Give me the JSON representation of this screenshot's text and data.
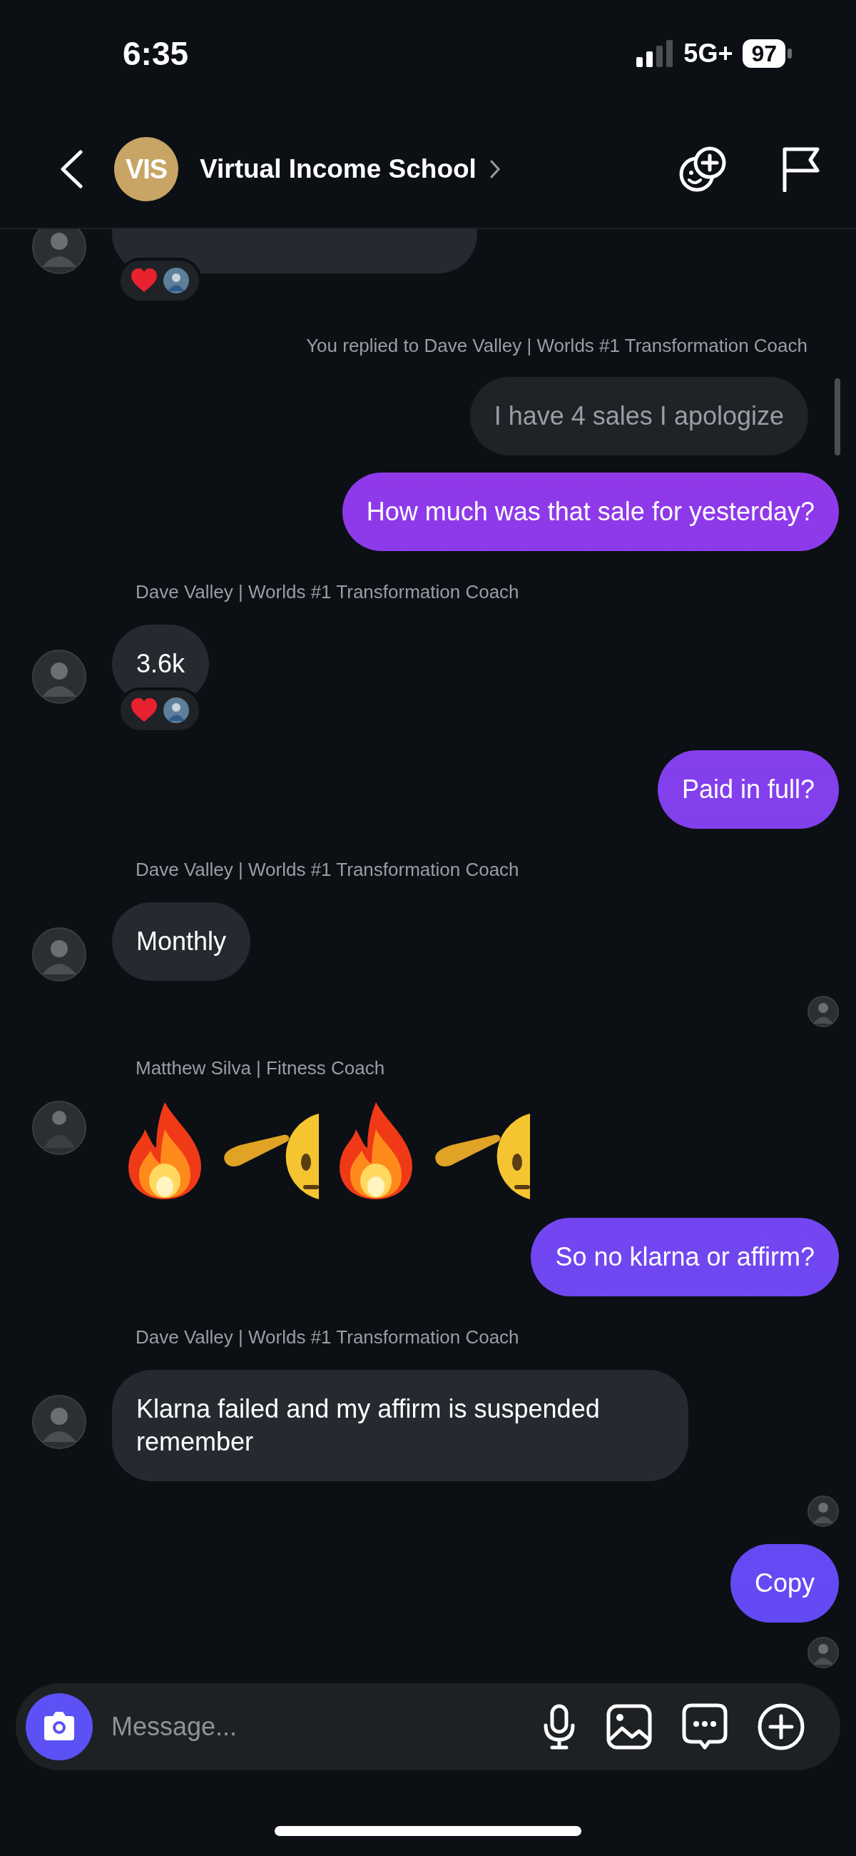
{
  "status_bar": {
    "time": "6:35",
    "network": "5G+",
    "battery": "97"
  },
  "header": {
    "avatar_text": "VIS",
    "title": "Virtual Income School"
  },
  "messages": [
    {
      "kind": "incoming",
      "reacted": true
    },
    {
      "kind": "note",
      "text": "You replied to Dave Valley | Worlds #1 Transformation Coach"
    },
    {
      "kind": "quote",
      "text": "I have 4 sales I apologize"
    },
    {
      "kind": "outgoing",
      "text": "How much was that sale for yesterday?"
    },
    {
      "kind": "sender",
      "text": "Dave Valley | Worlds #1 Transformation Coach"
    },
    {
      "kind": "incoming",
      "text": "3.6k",
      "reacted": true
    },
    {
      "kind": "outgoing",
      "text": "Paid in full?"
    },
    {
      "kind": "sender",
      "text": "Dave Valley | Worlds #1 Transformation Coach"
    },
    {
      "kind": "incoming",
      "text": "Monthly",
      "reacted": false
    },
    {
      "kind": "seen"
    },
    {
      "kind": "sender",
      "text": "Matthew Silva | Fitness Coach"
    },
    {
      "kind": "emoji"
    },
    {
      "kind": "outgoing",
      "text": "So no klarna or affirm?"
    },
    {
      "kind": "sender",
      "text": "Dave Valley | Worlds #1 Transformation Coach"
    },
    {
      "kind": "incoming",
      "text": "Klarna failed and my affirm is suspended remember",
      "reacted": false
    },
    {
      "kind": "seen"
    },
    {
      "kind": "outgoing",
      "text": "Copy"
    },
    {
      "kind": "seen"
    }
  ],
  "composer": {
    "placeholder": "Message..."
  }
}
